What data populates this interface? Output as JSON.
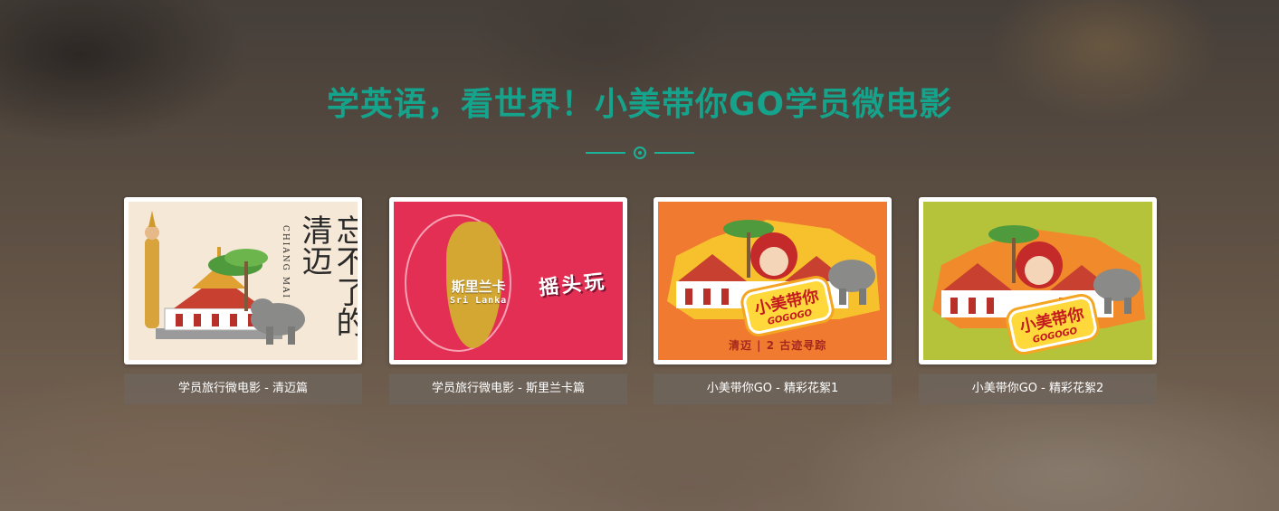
{
  "section": {
    "title": "学英语，看世界！小美带你GO学员微电影"
  },
  "colors": {
    "accent": "#15a38b",
    "caption_bg": "#6e645c"
  },
  "videos": [
    {
      "caption": "学员旅行微电影 - 清迈篇",
      "thumb_text": {
        "main": "忘不了的清迈",
        "latin": "CHIANG MAI"
      }
    },
    {
      "caption": "学员旅行微电影 - 斯里兰卡篇",
      "thumb_text": {
        "main": "斯里兰卡",
        "latin": "Sri Lanka",
        "tag": "摇头玩"
      }
    },
    {
      "caption": "小美带你GO - 精彩花絮1",
      "thumb_text": {
        "main": "小美带你",
        "latin": "GOGOGO",
        "sub": "清迈 | 2 古迹寻踪"
      }
    },
    {
      "caption": "小美带你GO - 精彩花絮2",
      "thumb_text": {
        "main": "小美带你",
        "latin": "GOGOGO"
      }
    }
  ]
}
